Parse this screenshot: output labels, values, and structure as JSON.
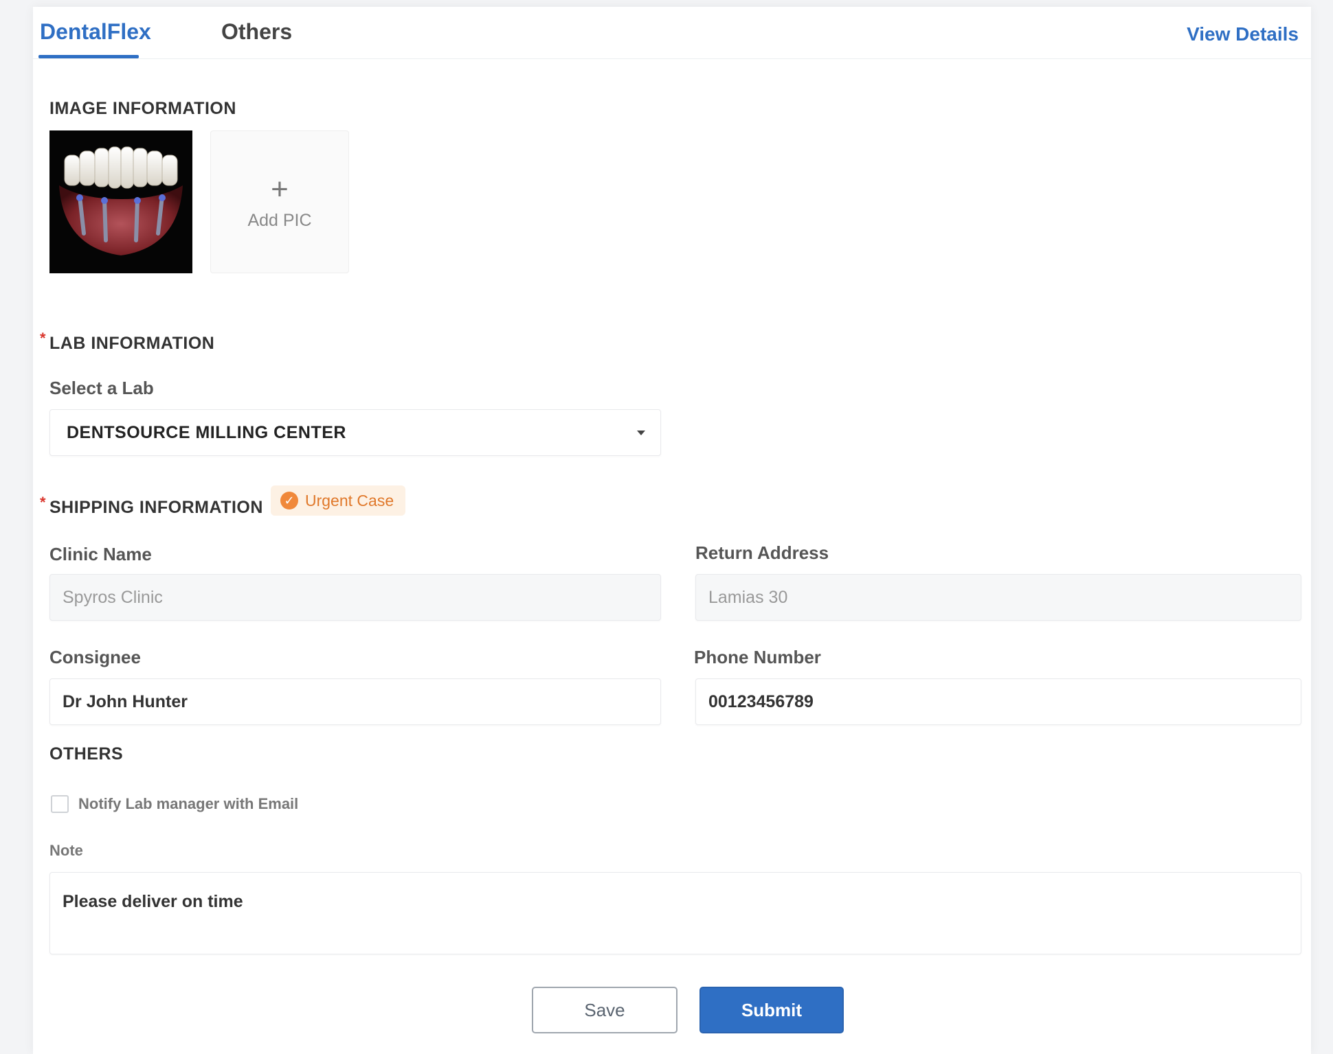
{
  "tabs": [
    {
      "label": "DentalFlex",
      "active": true
    },
    {
      "label": "Others",
      "active": false
    }
  ],
  "header": {
    "view_details": "View Details"
  },
  "image_section": {
    "title": "IMAGE INFORMATION",
    "add_pic_icon": "plus-icon",
    "add_pic_label": "Add PIC"
  },
  "lab_section": {
    "title": "LAB INFORMATION",
    "select_label": "Select a Lab",
    "selected_lab": "DENTSOURCE MILLING CENTER"
  },
  "shipping_section": {
    "title": "SHIPPING INFORMATION",
    "urgent_label": "Urgent Case",
    "urgent_checked": true,
    "clinic_name_label": "Clinic Name",
    "clinic_name_value": "Spyros Clinic",
    "return_address_label": "Return Address",
    "return_address_value": "Lamias 30",
    "consignee_label": "Consignee",
    "consignee_value": "Dr John Hunter",
    "phone_label": "Phone Number",
    "phone_value": "00123456789"
  },
  "others_section": {
    "title": "OTHERS",
    "notify_label": "Notify Lab manager with Email",
    "notify_checked": false,
    "note_label": "Note",
    "note_value": "Please deliver on time"
  },
  "actions": {
    "save_label": "Save",
    "submit_label": "Submit"
  },
  "colors": {
    "accent": "#2f6fc4",
    "urgent_bg": "#fdf1e4",
    "urgent_fg": "#e0782a",
    "required": "#d9342b"
  }
}
